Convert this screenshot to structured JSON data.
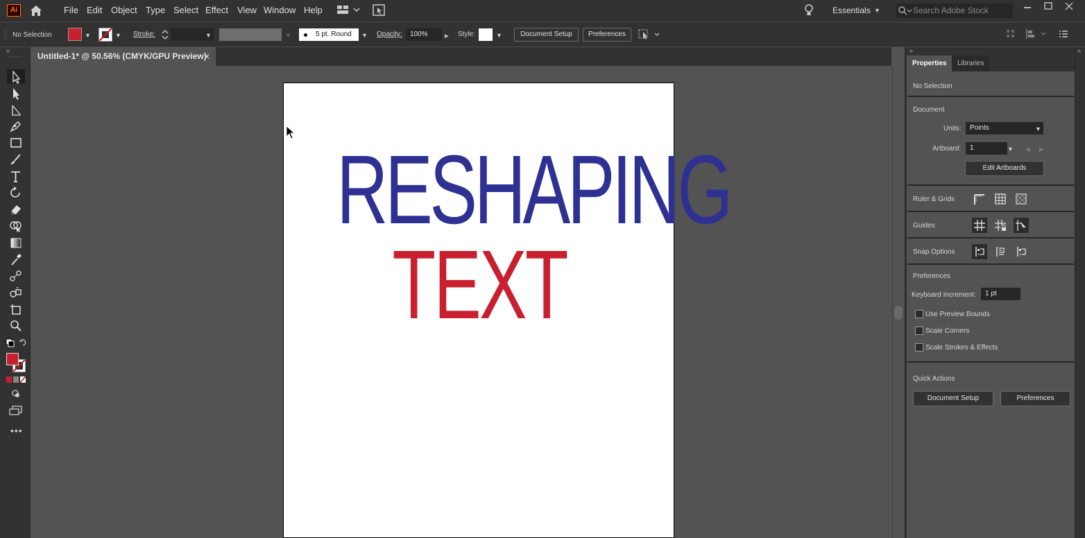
{
  "app": {
    "logo_text": "Ai"
  },
  "menu": [
    "File",
    "Edit",
    "Object",
    "Type",
    "Select",
    "Effect",
    "View",
    "Window",
    "Help"
  ],
  "workspace": {
    "label": "Essentials"
  },
  "search": {
    "placeholder": "Search Adobe Stock"
  },
  "control": {
    "selection": "No Selection",
    "stroke_label": "Stroke:",
    "brush_label": "5 pt. Round",
    "opacity_label": "Opacity:",
    "opacity_value": "100%",
    "style_label": "Style:",
    "document_setup": "Document Setup",
    "preferences": "Preferences",
    "fill_color": "#c8202f"
  },
  "document_tab": {
    "title": "Untitled-1* @ 50.56% (CMYK/GPU Preview)",
    "close": "×"
  },
  "artboard": {
    "line1": "RESHAPING",
    "line1_color": "#2e3192",
    "line2": "TEXT",
    "line2_color": "#c8202f"
  },
  "panel": {
    "tabs": [
      "Properties",
      "Libraries"
    ],
    "selection": "No Selection",
    "document": {
      "title": "Document",
      "units_label": "Units:",
      "units_value": "Points",
      "artboard_label": "Artboard:",
      "artboard_value": "1",
      "edit_artboards": "Edit Artboards"
    },
    "ruler_grids": "Ruler & Grids",
    "guides": "Guides",
    "snap_options": "Snap Options",
    "preferences": {
      "title": "Preferences",
      "keyboard_increment_label": "Keyboard Increment:",
      "keyboard_increment_value": "1 pt",
      "checkboxes": [
        "Use Preview Bounds",
        "Scale Corners",
        "Scale Strokes & Effects"
      ]
    },
    "quick_actions": {
      "title": "Quick Actions",
      "document_setup": "Document Setup",
      "preferences": "Preferences"
    }
  }
}
